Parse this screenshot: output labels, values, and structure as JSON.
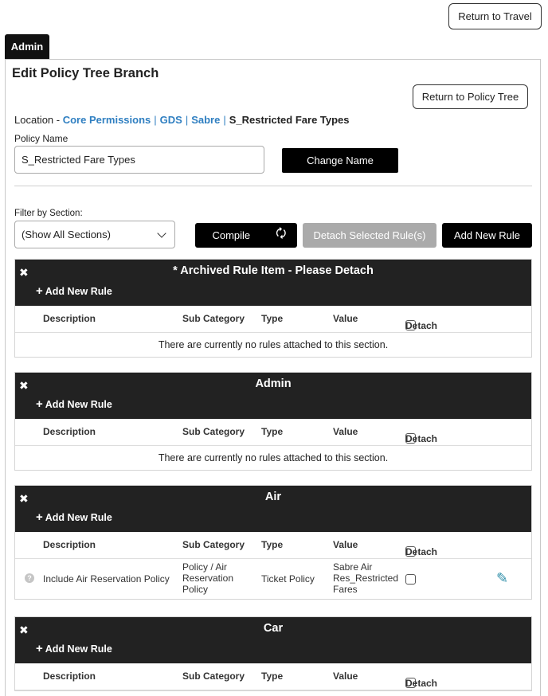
{
  "header": {
    "return_travel": "Return to Travel",
    "admin_tab": "Admin"
  },
  "page": {
    "title": "Edit Policy Tree Branch",
    "return_tree": "Return to Policy Tree"
  },
  "location": {
    "prefix": "Location -",
    "crumbs": [
      "Core Permissions",
      "GDS",
      "Sabre"
    ],
    "separator": "|",
    "current": "S_Restricted Fare Types"
  },
  "policy": {
    "label": "Policy Name",
    "value": "S_Restricted Fare Types",
    "change_name": "Change Name"
  },
  "filter": {
    "label": "Filter by Section:",
    "selected": "(Show All Sections)"
  },
  "toolbar": {
    "compile": "Compile",
    "compile_icon": "sync-icon",
    "detach_selected": "Detach Selected Rule(s)",
    "add_new_rule": "Add New Rule"
  },
  "columns": {
    "description": "Description",
    "sub_category": "Sub Category",
    "type": "Type",
    "value": "Value",
    "detach": "Detach"
  },
  "add_rule_label": "Add New Rule",
  "empty_message": "There are currently no rules attached to this section.",
  "sections": [
    {
      "title": "* Archived Rule Item - Please Detach"
    },
    {
      "title": "Admin"
    },
    {
      "title": "Air",
      "rule": {
        "description": "Include Air Reservation Policy",
        "sub_category": [
          "Policy / Air",
          "Reservation",
          "Policy"
        ],
        "type": "Ticket Policy",
        "value": [
          "Sabre Air",
          "Res_Restricted",
          "Fares"
        ]
      }
    },
    {
      "title": "Car"
    }
  ],
  "colors": {
    "link": "#2f7fc1",
    "header_bg": "#222222",
    "edit_icon": "#2b8ca7",
    "disabled_button": "#aaaaaa"
  }
}
